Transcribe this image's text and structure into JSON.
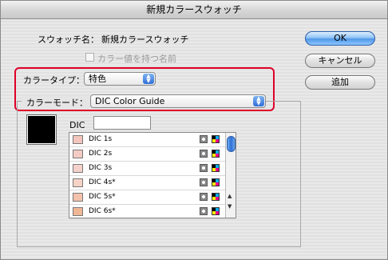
{
  "window": {
    "title": "新規カラースウォッチ"
  },
  "swatch_name": {
    "label": "スウォッチ名：",
    "value": "新規カラースウォッチ"
  },
  "color_value_name": {
    "label": "カラー値を持つ名前"
  },
  "color_type": {
    "label": "カラータイプ：",
    "value": "特色"
  },
  "color_mode": {
    "label": "カラーモード：",
    "value": "DIC Color Guide"
  },
  "dic": {
    "label": "DIC",
    "value": ""
  },
  "buttons": {
    "ok": "OK",
    "cancel": "キャンセル",
    "add": "追加"
  },
  "colors": {
    "highlight": "#e0002a",
    "preview": "#000000"
  },
  "swatches": [
    {
      "name": "DIC 1s",
      "color": "#f3c6bd"
    },
    {
      "name": "DIC 2s",
      "color": "#f4cbc4"
    },
    {
      "name": "DIC 3s",
      "color": "#f6d1cb"
    },
    {
      "name": "DIC 4s*",
      "color": "#f7d3c7"
    },
    {
      "name": "DIC 5s*",
      "color": "#f4c2ac"
    },
    {
      "name": "DIC 6s*",
      "color": "#f0b795"
    }
  ]
}
